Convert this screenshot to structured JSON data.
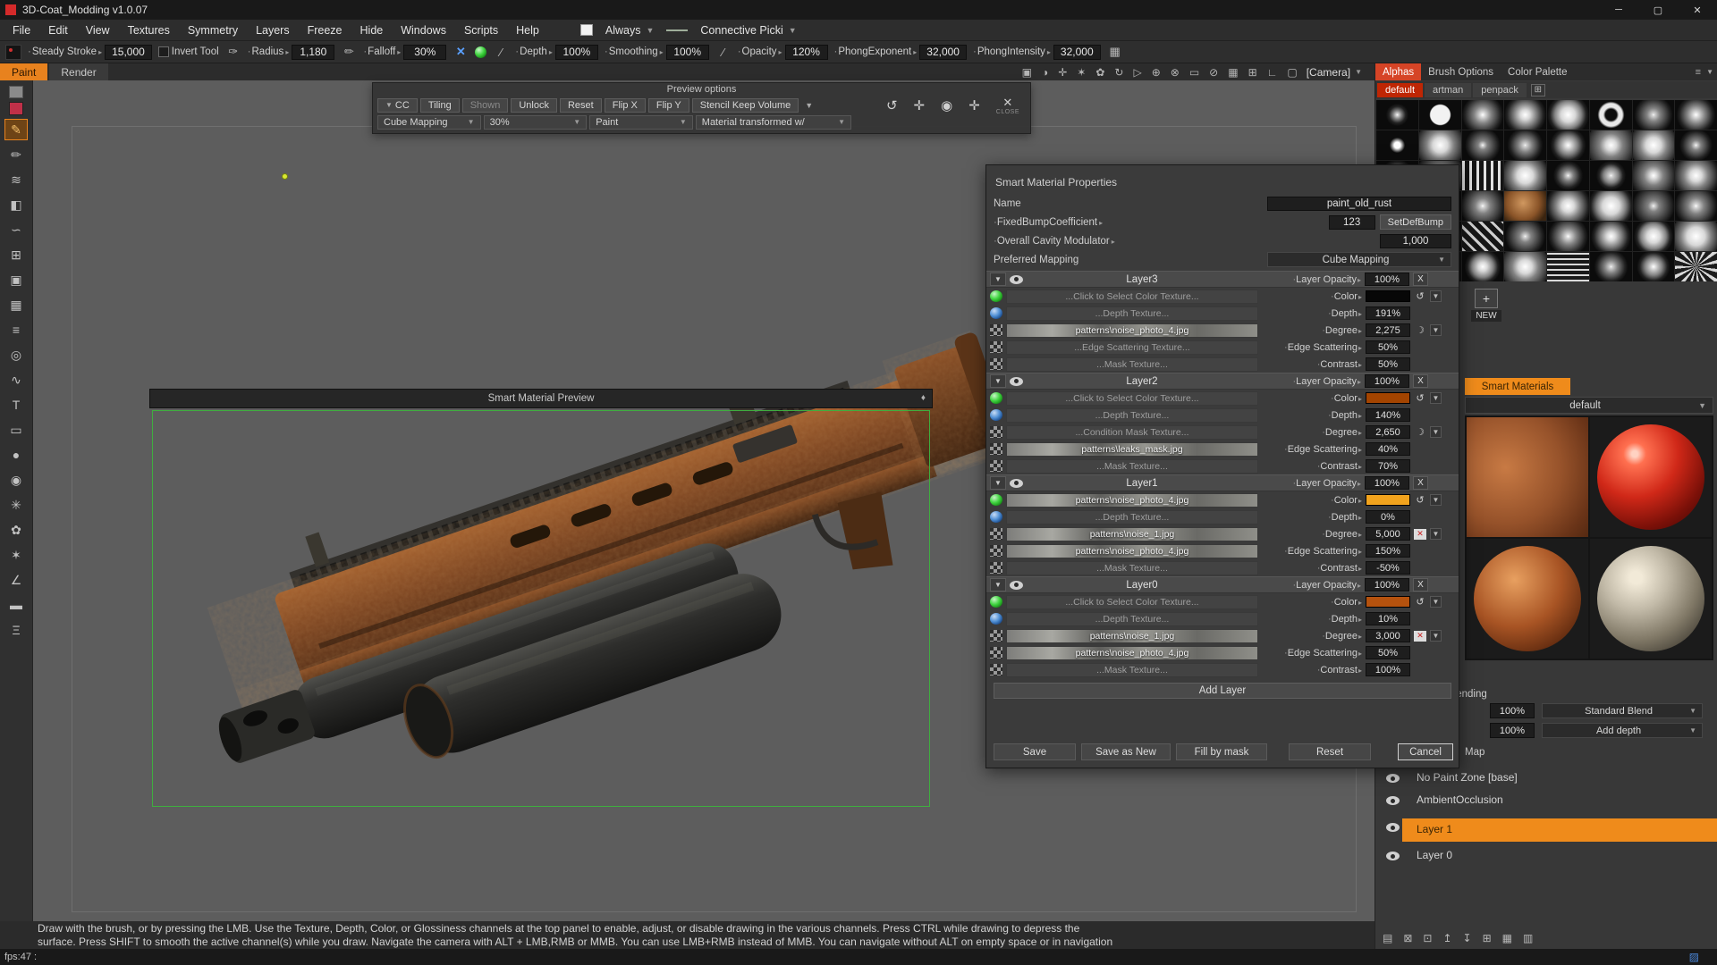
{
  "window": {
    "title": "3D-Coat_Modding v1.0.07"
  },
  "menu": {
    "items": [
      "File",
      "Edit",
      "View",
      "Textures",
      "Symmetry",
      "Layers",
      "Freeze",
      "Hide",
      "Windows",
      "Scripts",
      "Help"
    ],
    "always": "Always",
    "connective": "Connective Picki"
  },
  "toolbar": {
    "segments": [
      {
        "type": "icon",
        "name": "brush-preview-icon",
        "glyph": "dot"
      },
      {
        "type": "param",
        "label": "Steady Stroke",
        "value": "15,000"
      },
      {
        "type": "check",
        "label": "Invert Tool"
      },
      {
        "type": "icon",
        "name": "brush-tip-icon",
        "glyph": "brush"
      },
      {
        "type": "param",
        "label": "Radius",
        "value": "1,180"
      },
      {
        "type": "icon",
        "name": "pencil-icon",
        "glyph": "pencil"
      },
      {
        "type": "param",
        "label": "Falloff",
        "value": "30%"
      },
      {
        "type": "icon",
        "name": "blue-cross-icon",
        "glyph": "bluex"
      },
      {
        "type": "icon",
        "name": "green-sphere-icon",
        "glyph": "greenball"
      },
      {
        "type": "icon",
        "name": "stroke-icon",
        "glyph": "slash"
      },
      {
        "type": "param",
        "label": "Depth",
        "value": "100%"
      },
      {
        "type": "param",
        "label": "Smoothing",
        "value": "100%"
      },
      {
        "type": "icon",
        "name": "stroke-icon-2",
        "glyph": "slash"
      },
      {
        "type": "param",
        "label": "Opacity",
        "value": "120%"
      },
      {
        "type": "param",
        "label": "PhongExponent",
        "value": "32,000"
      },
      {
        "type": "param",
        "label": "PhongIntensity",
        "value": "32,000"
      },
      {
        "type": "icon",
        "name": "grid-toggle-icon",
        "glyph": "grid"
      }
    ]
  },
  "tabs": {
    "docs": [
      {
        "label": "Paint",
        "selected": true
      },
      {
        "label": "Render",
        "selected": false
      }
    ],
    "view_icons": [
      "texture-view-icon",
      "shading-icon",
      "pivot-icon",
      "light-icon",
      "flower-icon",
      "rotate-view-icon",
      "play-icon",
      "zoom-icon",
      "multiply-icon",
      "frame-icon",
      "disable-icon",
      "wireframe-icon",
      "snap-grid-icon",
      "axis-icon",
      "border-icon"
    ],
    "camera": "[Camera]"
  },
  "tools": {
    "items": [
      {
        "name": "current-alpha-chip",
        "kind": "chip"
      },
      {
        "name": "color-swatch",
        "kind": "swatch"
      },
      {
        "name": "paint-brush-tool",
        "selected": true
      },
      {
        "name": "pencil-tool"
      },
      {
        "name": "airbrush-tool"
      },
      {
        "name": "fill-tool"
      },
      {
        "name": "smudge-tool"
      },
      {
        "name": "clone-tool"
      },
      {
        "name": "stamp-tool"
      },
      {
        "name": "image-tool"
      },
      {
        "name": "layers-tool"
      },
      {
        "name": "picker-tool"
      },
      {
        "name": "curve-tool"
      },
      {
        "name": "text-tool"
      },
      {
        "name": "rect-tool"
      },
      {
        "name": "blob-tool"
      },
      {
        "name": "eye-tool"
      },
      {
        "name": "pattern-tool"
      },
      {
        "name": "ribbon-tool"
      },
      {
        "name": "wand-tool"
      },
      {
        "name": "ruler-tool"
      },
      {
        "name": "roller-tool"
      },
      {
        "name": "comb-tool"
      }
    ]
  },
  "preview_options": {
    "title": "Preview options",
    "buttons": [
      {
        "label": "CC",
        "chevron": true
      },
      {
        "label": "Tiling"
      },
      {
        "label": "Shown",
        "dim": true
      },
      {
        "label": "Unlock"
      },
      {
        "label": "Reset"
      },
      {
        "label": "Flip X"
      },
      {
        "label": "Flip Y"
      },
      {
        "label": "Stencil Keep Volume"
      }
    ],
    "dropdowns": [
      "Cube Mapping",
      "30%",
      "Paint",
      "Material transformed w/"
    ],
    "close_label": "CLOSE"
  },
  "preview_window": {
    "title": "Smart Material Preview"
  },
  "properties": {
    "title": "Smart Material Properties",
    "name_label": "Name",
    "name_value": "paint_old_rust",
    "fields": [
      {
        "label": "FixedBumpCoefficient",
        "value": "123",
        "button": "SetDefBump"
      },
      {
        "label": "Overall Cavity Modulator",
        "value": "1,000"
      },
      {
        "label": "Preferred Mapping",
        "dropdown": "Cube Mapping"
      }
    ],
    "opacity_label": "Layer Opacity",
    "delete_label": "X",
    "layers": [
      {
        "name": "Layer3",
        "opacity": "100%",
        "rows": [
          {
            "icon": "color-sphere",
            "slot": "...Click to Select Color Texture...",
            "param": "Color",
            "swatch": "#070707",
            "extras": [
              "undo",
              "chev"
            ]
          },
          {
            "icon": "depth-sphere",
            "slot": "...Depth Texture...",
            "param": "Depth",
            "value": "191%"
          },
          {
            "icon": "checker",
            "slot": "patterns\\noise_photo_4.jpg",
            "thumb": true,
            "param": "Degree",
            "value": "2,275",
            "extras": [
              "moon",
              "chev"
            ]
          },
          {
            "icon": "checker",
            "slot": "...Edge Scattering Texture...",
            "param": "Edge Scattering",
            "value": "50%"
          },
          {
            "icon": "checker",
            "slot": "...Mask Texture...",
            "param": "Contrast",
            "value": "50%"
          }
        ]
      },
      {
        "name": "Layer2",
        "opacity": "100%",
        "rows": [
          {
            "icon": "color-sphere",
            "slot": "...Click to Select Color Texture...",
            "param": "Color",
            "swatch": "#a34400",
            "extras": [
              "undo",
              "chev"
            ]
          },
          {
            "icon": "depth-sphere",
            "slot": "...Depth Texture...",
            "param": "Depth",
            "value": "140%"
          },
          {
            "icon": "checker",
            "slot": "...Condition Mask Texture...",
            "param": "Degree",
            "value": "2,650",
            "extras": [
              "moon",
              "chev"
            ]
          },
          {
            "icon": "checker",
            "slot": "patterns\\leaks_mask.jpg",
            "thumb": true,
            "param": "Edge Scattering",
            "value": "40%"
          },
          {
            "icon": "checker",
            "slot": "...Mask Texture...",
            "param": "Contrast",
            "value": "70%"
          }
        ]
      },
      {
        "name": "Layer1",
        "opacity": "100%",
        "rows": [
          {
            "icon": "color-sphere",
            "slot": "patterns\\noise_photo_4.jpg",
            "thumb": true,
            "param": "Color",
            "swatch": "#f2a31d",
            "extras": [
              "undo",
              "chev"
            ]
          },
          {
            "icon": "depth-sphere",
            "slot": "...Depth Texture...",
            "param": "Depth",
            "value": "0%"
          },
          {
            "icon": "checker",
            "slot": "patterns\\noise_1.jpg",
            "thumb": true,
            "param": "Degree",
            "value": "5,000",
            "extras": [
              "redx",
              "chev"
            ]
          },
          {
            "icon": "checker",
            "slot": "patterns\\noise_photo_4.jpg",
            "thumb": true,
            "param": "Edge Scattering",
            "value": "150%"
          },
          {
            "icon": "checker",
            "slot": "...Mask Texture...",
            "param": "Contrast",
            "value": "-50%"
          }
        ]
      },
      {
        "name": "Layer0",
        "opacity": "100%",
        "rows": [
          {
            "icon": "color-sphere",
            "slot": "...Click to Select Color Texture...",
            "param": "Color",
            "swatch": "#b5520e",
            "extras": [
              "undo",
              "chev"
            ]
          },
          {
            "icon": "depth-sphere",
            "slot": "...Depth Texture...",
            "param": "Depth",
            "value": "10%"
          },
          {
            "icon": "checker",
            "slot": "patterns\\noise_1.jpg",
            "thumb": true,
            "param": "Degree",
            "value": "3,000",
            "extras": [
              "redx",
              "chev"
            ]
          },
          {
            "icon": "checker",
            "slot": "patterns\\noise_photo_4.jpg",
            "thumb": true,
            "param": "Edge Scattering",
            "value": "50%"
          },
          {
            "icon": "checker",
            "slot": "...Mask Texture...",
            "param": "Contrast",
            "value": "100%"
          }
        ]
      }
    ],
    "add_layer": "Add Layer",
    "buttons": [
      "Save",
      "Save as New",
      "Fill by mask",
      "Reset",
      "Cancel"
    ]
  },
  "right_panel": {
    "tabs": [
      {
        "label": "Alphas",
        "selected": true
      },
      {
        "label": "Brush Options",
        "selected": false
      },
      {
        "label": "Color Palette",
        "selected": false
      }
    ],
    "alpha_tabs": [
      {
        "label": "default",
        "selected": true
      },
      {
        "label": "artman",
        "selected": false
      },
      {
        "label": "penpack",
        "selected": false
      }
    ],
    "alpha_count": 48,
    "new_label": "NEW",
    "smart_materials": {
      "tab_label": "Smart Materials",
      "selected_folder": "default",
      "items": [
        {
          "name": "rust-closeup-material",
          "selected": true
        },
        {
          "name": "red-glossy-material",
          "selected": false
        },
        {
          "name": "rust-sphere-material",
          "selected": false
        },
        {
          "name": "clay-sphere-material",
          "selected": false
        }
      ]
    },
    "blending": {
      "label": "Blending",
      "rows": [
        {
          "value": "100%",
          "mode": "Standard Blend"
        },
        {
          "value": "100%",
          "mode": "Add depth"
        }
      ]
    },
    "map_label": "Map",
    "layer_stack": [
      {
        "label": "No Paint Zone [base]",
        "selected": false
      },
      {
        "label": "AmbientOcclusion",
        "selected": false
      },
      {
        "label": "Layer 1",
        "selected": true
      },
      {
        "label": "Layer 0",
        "selected": false
      }
    ],
    "dock_icons": [
      "list-options-icon",
      "delete-layer-icon",
      "duplicate-layer-icon",
      "move-up-icon",
      "move-down-icon",
      "merge-layer-icon",
      "export-layer-icon",
      "folder-icon"
    ]
  },
  "status": {
    "line1": "Draw with the brush, or by pressing the LMB. Use the Texture, Depth, Color, or Glossiness channels at the top panel to enable, adjust, or disable drawing in the various channels. Press CTRL while drawing to depress the",
    "line2": "surface. Press SHIFT to smooth the active channel(s) while you draw. Navigate the camera with ALT + LMB,RMB or MMB. You can use LMB+RMB instead of MMB. You can navigate without ALT on empty space or in navigation",
    "fps": "fps:47 :"
  }
}
